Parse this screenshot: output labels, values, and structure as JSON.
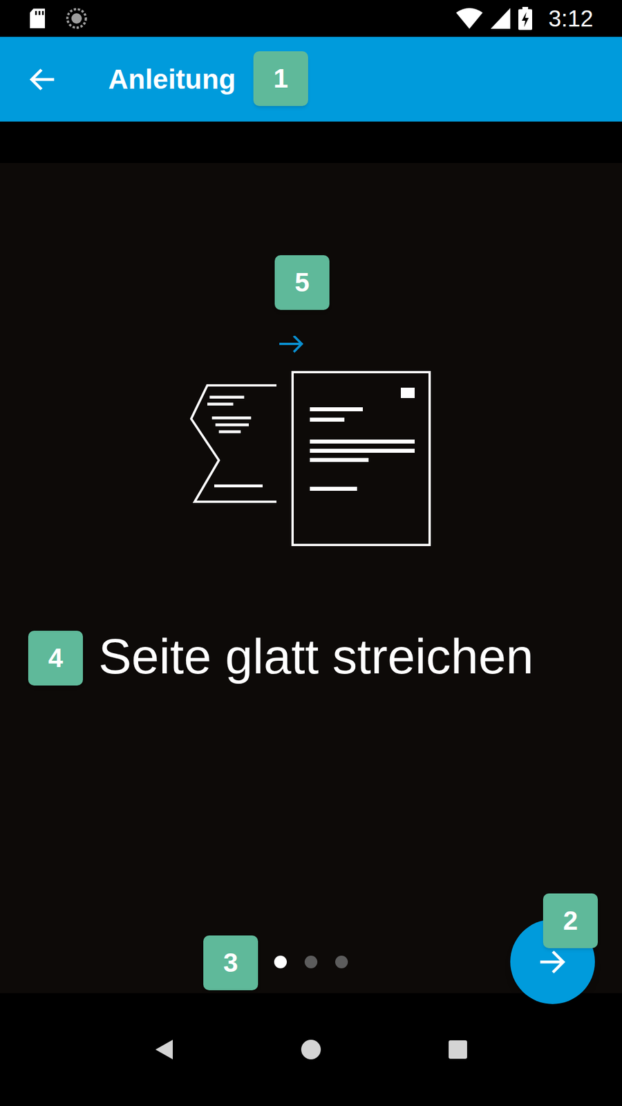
{
  "status_bar": {
    "time": "3:12"
  },
  "app_bar": {
    "title": "Anleitung"
  },
  "page": {
    "caption": "Seite glatt streichen",
    "pages": [
      {
        "selected": true
      },
      {
        "selected": false
      },
      {
        "selected": false
      }
    ]
  },
  "annotations": [
    {
      "label": "1"
    },
    {
      "label": "2"
    },
    {
      "label": "3"
    },
    {
      "label": "4"
    },
    {
      "label": "5"
    }
  ]
}
